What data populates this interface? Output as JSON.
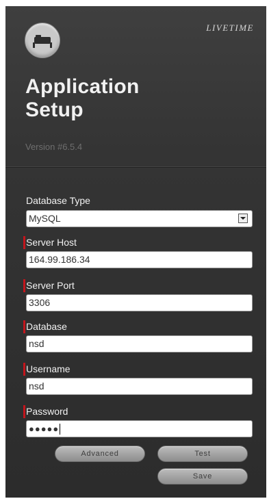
{
  "header": {
    "brand": "LIVETIME",
    "title_line1": "Application",
    "title_line2": "Setup",
    "version": "Version #6.5.4"
  },
  "form": {
    "database_type": {
      "label": "Database Type",
      "value": "MySQL"
    },
    "server_host": {
      "label": "Server Host",
      "value": "164.99.186.34"
    },
    "server_port": {
      "label": "Server Port",
      "value": "3306"
    },
    "database": {
      "label": "Database",
      "value": "nsd"
    },
    "username": {
      "label": "Username",
      "value": "nsd"
    },
    "password": {
      "label": "Password",
      "value": "●●●●●"
    }
  },
  "buttons": {
    "advanced": "Advanced",
    "test": "Test",
    "save": "Save"
  },
  "colors": {
    "panel": "#343434",
    "required_marker": "#c4151c",
    "button": "#a4a4a4"
  }
}
